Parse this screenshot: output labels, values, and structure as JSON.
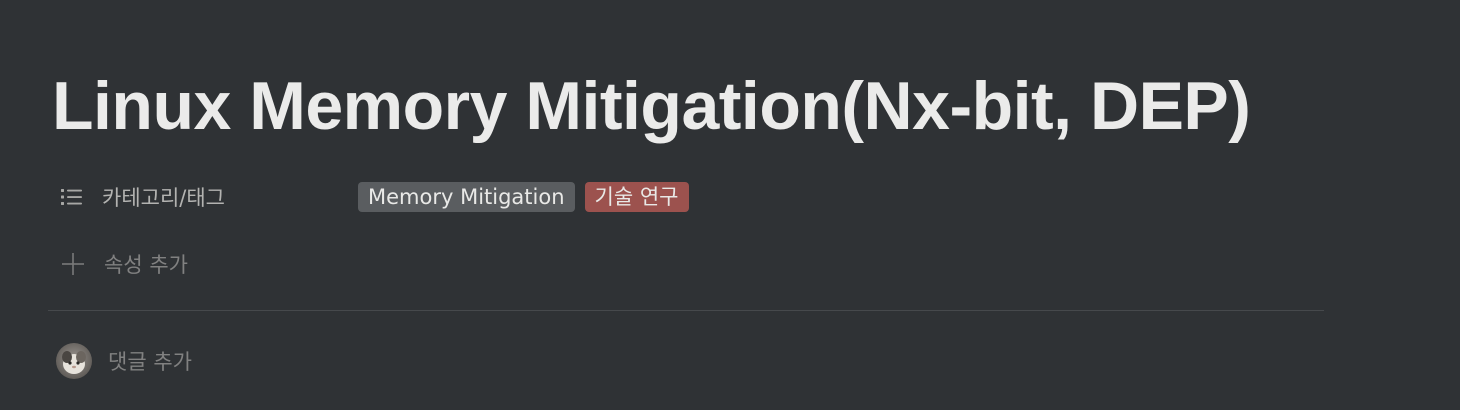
{
  "page": {
    "title": "Linux Memory Mitigation(Nx-bit, DEP)"
  },
  "properties": [
    {
      "icon": "list-icon",
      "label": "카테고리/태그",
      "tags": [
        {
          "label": "Memory Mitigation",
          "color": "#5a5d60"
        },
        {
          "label": "기술 연구",
          "color": "#9c524e"
        }
      ]
    }
  ],
  "add_property": {
    "icon": "plus-icon",
    "label": "속성 추가"
  },
  "comments": {
    "avatar": "user-avatar",
    "placeholder": "댓글 추가"
  },
  "colors": {
    "background": "#2f3235",
    "title_text": "#ebebea",
    "muted_text": "#818181"
  }
}
